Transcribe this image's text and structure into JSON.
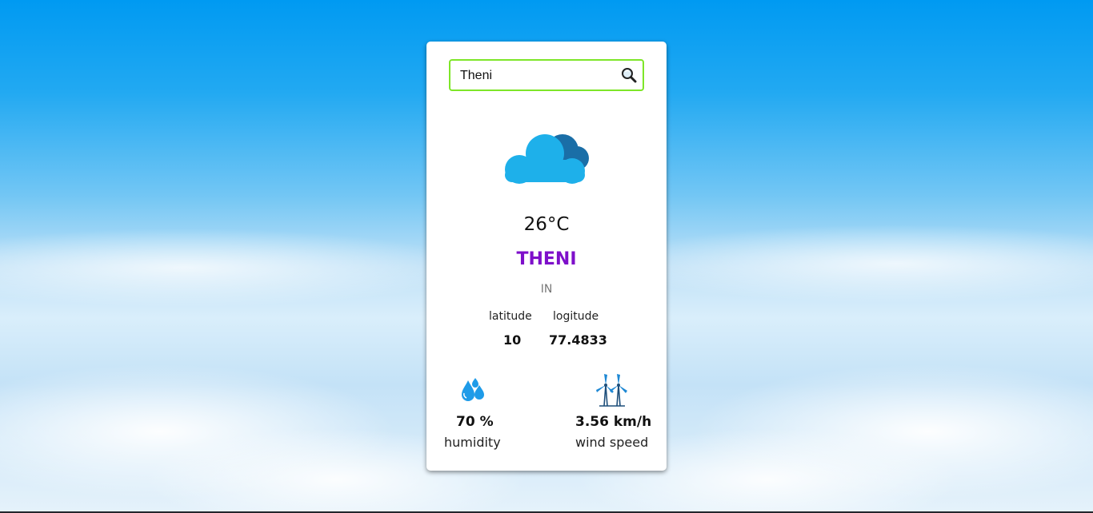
{
  "search": {
    "value": "Theni",
    "icon": "search-icon"
  },
  "weather": {
    "icon": "cloud-icon",
    "temperature": "26°C",
    "city": "THENI",
    "country": "IN"
  },
  "coordinates": {
    "latitude_label": "latitude",
    "latitude_value": "10",
    "longitude_label": "logitude",
    "longitude_value": "77.4833"
  },
  "stats": {
    "humidity_icon": "water-drops-icon",
    "humidity_value": "70 %",
    "humidity_label": "humidity",
    "wind_icon": "wind-turbine-icon",
    "wind_value": "3.56 km/h",
    "wind_label": "wind speed"
  },
  "colors": {
    "accent_border": "#7ee628",
    "city_text": "#7e0fca",
    "cloud_front": "#1eb0ea",
    "cloud_back": "#1a6ea7"
  }
}
